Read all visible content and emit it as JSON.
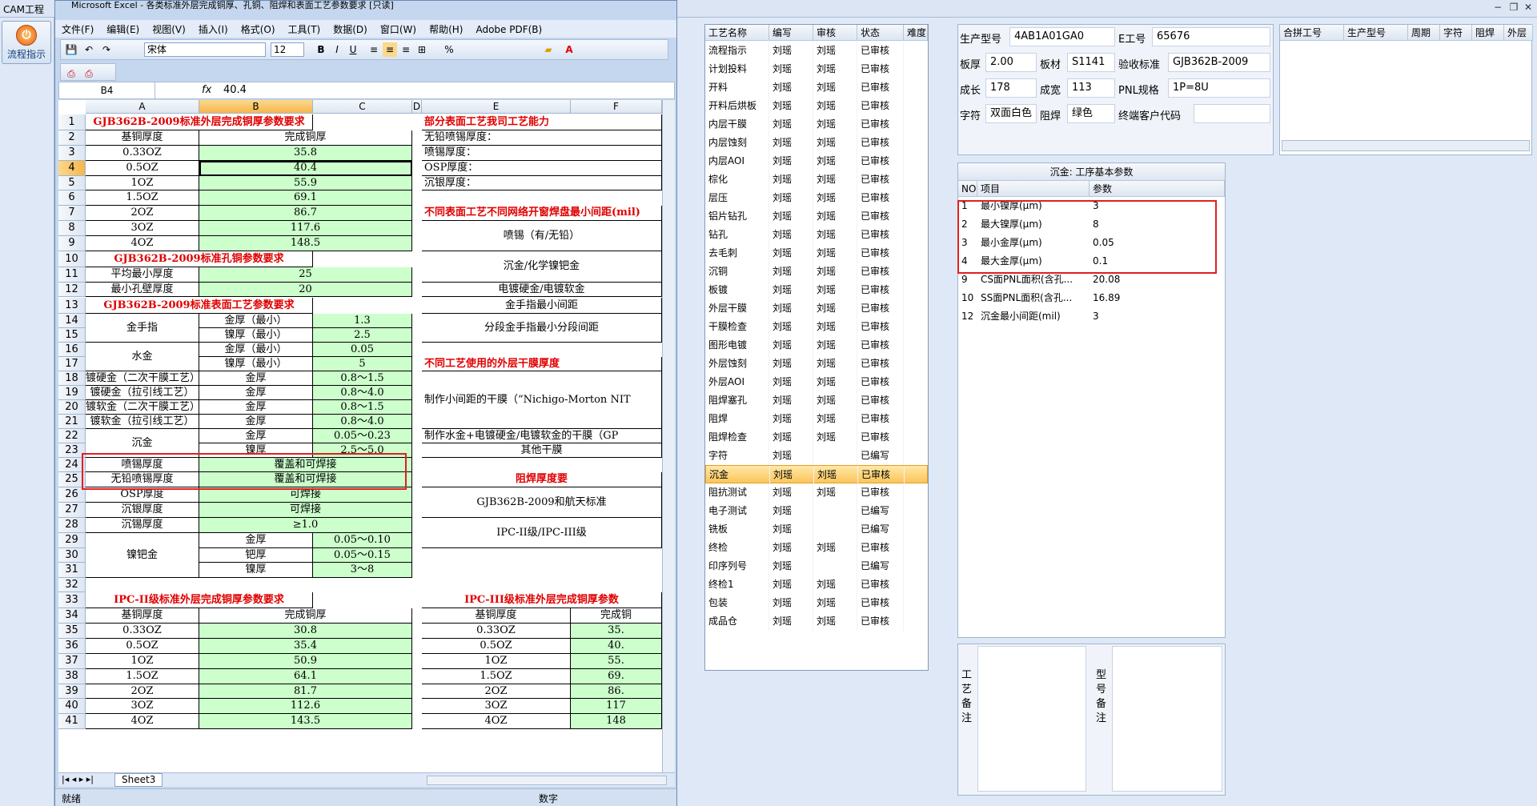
{
  "app": {
    "tab": "CAM工程",
    "flow_button": "流程指示"
  },
  "excel": {
    "title": "Microsoft Excel - 各类标准外层完成铜厚、孔铜、阻焊和表面工艺参数要求 [只读]",
    "menus": [
      "文件(F)",
      "编辑(E)",
      "视图(V)",
      "插入(I)",
      "格式(O)",
      "工具(T)",
      "数据(D)",
      "窗口(W)",
      "帮助(H)",
      "Adobe PDF(B)"
    ],
    "font": "宋体",
    "font_size": "12",
    "name_box": "B4",
    "formula": "40.4",
    "columns": [
      "A",
      "B",
      "C",
      "D",
      "E",
      "F"
    ],
    "rows": [
      "1",
      "2",
      "3",
      "4",
      "5",
      "6",
      "7",
      "8",
      "9",
      "10",
      "11",
      "12",
      "13",
      "14",
      "15",
      "16",
      "17",
      "18",
      "19",
      "20",
      "21",
      "22",
      "23",
      "24",
      "25",
      "26",
      "27",
      "28",
      "29",
      "30",
      "31",
      "32",
      "33",
      "34",
      "35",
      "36",
      "37",
      "38",
      "39",
      "40",
      "41"
    ],
    "cells": {
      "r1": "GJB362B-2009标准外层完成铜厚参数要求",
      "r2a": "基铜厚度",
      "r2b": "完成铜厚",
      "r3a": "0.33OZ",
      "r3b": "35.8",
      "r4a": "0.5OZ",
      "r4b": "40.4",
      "r5a": "1OZ",
      "r5b": "55.9",
      "r6a": "1.5OZ",
      "r6b": "69.1",
      "r7a": "2OZ",
      "r7b": "86.7",
      "r8a": "3OZ",
      "r8b": "117.6",
      "r9a": "4OZ",
      "r9b": "148.5",
      "r10": "GJB362B-2009标准孔铜参数要求",
      "r11a": "平均最小厚度",
      "r11b": "25",
      "r12a": "最小孔壁厚度",
      "r12b": "20",
      "r13": "GJB362B-2009标准表面工艺参数要求",
      "jsz": "金手指",
      "r14b": "金厚（最小）",
      "r14c": "1.3",
      "r15b": "镍厚（最小）",
      "r15c": "2.5",
      "sj": "水金",
      "r16b": "金厚（最小）",
      "r16c": "0.05",
      "r17b": "镍厚（最小）",
      "r17c": "5",
      "r18a": "镀硬金（二次干膜工艺）",
      "r18b": "金厚",
      "r18c": "0.8～1.5",
      "r19a": "镀硬金（拉引线工艺）",
      "r19b": "金厚",
      "r19c": "0.8～4.0",
      "r20a": "镀软金（二次干膜工艺）",
      "r20b": "金厚",
      "r20c": "0.8～1.5",
      "r21a": "镀软金（拉引线工艺）",
      "r21b": "金厚",
      "r21c": "0.8～4.0",
      "cj": "沉金",
      "r22b": "金厚",
      "r22c": "0.05～0.23",
      "r23b": "镍厚",
      "r23c": "2.5～5.0",
      "r24a": "喷锡厚度",
      "r24b": "覆盖和可焊接",
      "r25a": "无铅喷锡厚度",
      "r25b": "覆盖和可焊接",
      "r26a": "OSP厚度",
      "r26b": "可焊接",
      "r27a": "沉银厚度",
      "r27b": "可焊接",
      "r28a": "沉锡厚度",
      "r28b": "≥1.0",
      "njj": "镍钯金",
      "r29b": "金厚",
      "r29c": "0.05～0.10",
      "r30b": "钯厚",
      "r30c": "0.05～0.15",
      "r31b": "镍厚",
      "r31c": "3～8",
      "r33": "IPC-II级标准外层完成铜厚参数要求",
      "r34a": "基铜厚度",
      "r34b": "完成铜厚",
      "r35a": "0.33OZ",
      "r35b": "30.8",
      "r36a": "0.5OZ",
      "r36b": "35.4",
      "r37a": "1OZ",
      "r37b": "50.9",
      "r38a": "1.5OZ",
      "r38b": "64.1",
      "r39a": "2OZ",
      "r39b": "81.7",
      "r40a": "3OZ",
      "r40b": "112.6",
      "r41a": "4OZ",
      "r41b": "143.5",
      "e1": "部分表面工艺我司工艺能力",
      "e2": "无铅喷锡厚度：",
      "e3": "喷锡厚度：",
      "e4": "OSP厚度：",
      "e5": "沉银厚度：",
      "e7": "不同表面工艺不同网络开窗焊盘最小间距(mil)",
      "e8": "喷锡（有/无铅）",
      "e10": "沉金/化学镍钯金",
      "e12": "电镀硬金/电镀软金",
      "e13": "金手指最小间距",
      "e14": "分段金手指最小分段间距",
      "e17": "不同工艺使用的外层干膜厚度",
      "e19": "制作小间距的干膜（“Nichigo-Morton NIT",
      "e22": "制作水金+电镀硬金/电镀软金的干膜（GP",
      "e23": "其他干膜",
      "e25": "阻焊厚度要",
      "e26": "GJB362B-2009和航天标准",
      "e28": "IPC-II级/IPC-III级",
      "e33": "IPC-III级标准外层完成铜厚参数",
      "e34a": "基铜厚度",
      "e34b": "完成铜",
      "e35a": "0.33OZ",
      "e35b": "35.",
      "e36a": "0.5OZ",
      "e36b": "40.",
      "e37a": "1OZ",
      "e37b": "55.",
      "e38a": "1.5OZ",
      "e38b": "69.",
      "e39a": "2OZ",
      "e39b": "86.",
      "e40a": "3OZ",
      "e40b": "117",
      "e41a": "4OZ",
      "e41b": "148"
    },
    "sheet_tab": "Sheet3",
    "status_left": "就绪",
    "status_mid": "数字"
  },
  "process": {
    "headers": [
      "工艺名称",
      "编写",
      "审核",
      "状态",
      "难度"
    ],
    "rows": [
      [
        "流程指示",
        "刘瑶",
        "刘瑶",
        "已审核"
      ],
      [
        "计划投料",
        "刘瑶",
        "刘瑶",
        "已审核"
      ],
      [
        "开料",
        "刘瑶",
        "刘瑶",
        "已审核"
      ],
      [
        "开料后烘板",
        "刘瑶",
        "刘瑶",
        "已审核"
      ],
      [
        "内层干膜",
        "刘瑶",
        "刘瑶",
        "已审核"
      ],
      [
        "内层蚀刻",
        "刘瑶",
        "刘瑶",
        "已审核"
      ],
      [
        "内层AOI",
        "刘瑶",
        "刘瑶",
        "已审核"
      ],
      [
        "棕化",
        "刘瑶",
        "刘瑶",
        "已审核"
      ],
      [
        "层压",
        "刘瑶",
        "刘瑶",
        "已审核"
      ],
      [
        "铝片钻孔",
        "刘瑶",
        "刘瑶",
        "已审核"
      ],
      [
        "钻孔",
        "刘瑶",
        "刘瑶",
        "已审核"
      ],
      [
        "去毛刺",
        "刘瑶",
        "刘瑶",
        "已审核"
      ],
      [
        "沉铜",
        "刘瑶",
        "刘瑶",
        "已审核"
      ],
      [
        "板镀",
        "刘瑶",
        "刘瑶",
        "已审核"
      ],
      [
        "外层干膜",
        "刘瑶",
        "刘瑶",
        "已审核"
      ],
      [
        "干膜检查",
        "刘瑶",
        "刘瑶",
        "已审核"
      ],
      [
        "图形电镀",
        "刘瑶",
        "刘瑶",
        "已审核"
      ],
      [
        "外层蚀刻",
        "刘瑶",
        "刘瑶",
        "已审核"
      ],
      [
        "外层AOI",
        "刘瑶",
        "刘瑶",
        "已审核"
      ],
      [
        "阻焊塞孔",
        "刘瑶",
        "刘瑶",
        "已审核"
      ],
      [
        "阻焊",
        "刘瑶",
        "刘瑶",
        "已审核"
      ],
      [
        "阻焊检查",
        "刘瑶",
        "刘瑶",
        "已审核"
      ],
      [
        "字符",
        "刘瑶",
        "",
        "已编写"
      ],
      [
        "沉金",
        "刘瑶",
        "刘瑶",
        "已审核"
      ],
      [
        "阻抗测试",
        "刘瑶",
        "刘瑶",
        "已审核"
      ],
      [
        "电子测试",
        "刘瑶",
        "",
        "已编写"
      ],
      [
        "铣板",
        "刘瑶",
        "",
        "已编写"
      ],
      [
        "终检",
        "刘瑶",
        "刘瑶",
        "已审核"
      ],
      [
        "印序列号",
        "刘瑶",
        "",
        "已编写"
      ],
      [
        "终检1",
        "刘瑶",
        "刘瑶",
        "已审核"
      ],
      [
        "包装",
        "刘瑶",
        "刘瑶",
        "已审核"
      ],
      [
        "成品仓",
        "刘瑶",
        "刘瑶",
        "已审核"
      ]
    ],
    "selected_index": 23
  },
  "info": {
    "model_label": "生产型号",
    "model": "4AB1A01GA0",
    "e_label": "E工号",
    "e_no": "65676",
    "thick_label": "板厚",
    "thick": "2.00",
    "mat_label": "板材",
    "mat": "S1141",
    "std_label": "验收标准",
    "std": "GJB362B-2009",
    "len_label": "成长",
    "len": "178",
    "wid_label": "成宽",
    "wid": "113",
    "pnl_label": "PNL规格",
    "pnl": "1P=8U",
    "char_label": "字符",
    "char": "双面白色",
    "mask_label": "阻焊",
    "mask": "绿色",
    "cust_label": "终端客户代码",
    "cust": ""
  },
  "merge": {
    "headers": [
      "合拼工号",
      "生产型号",
      "周期",
      "字符",
      "阻焊",
      "外层"
    ]
  },
  "params": {
    "title": "沉金: 工序基本参数",
    "headers": [
      "NO",
      "项目",
      "参数"
    ],
    "rows": [
      [
        "1",
        "最小镍厚(μm)",
        "3"
      ],
      [
        "2",
        "最大镍厚(μm)",
        "8"
      ],
      [
        "3",
        "最小金厚(μm)",
        "0.05"
      ],
      [
        "4",
        "最大金厚(μm)",
        "0.1"
      ],
      [
        "9",
        "CS面PNL面积(含孔...",
        "20.08"
      ],
      [
        "10",
        "SS面PNL面积(含孔...",
        "16.89"
      ],
      [
        "12",
        "沉金最小间距(mil)",
        "3"
      ]
    ]
  },
  "notes": {
    "process_label": "工艺备注",
    "model_label": "型号备注"
  }
}
